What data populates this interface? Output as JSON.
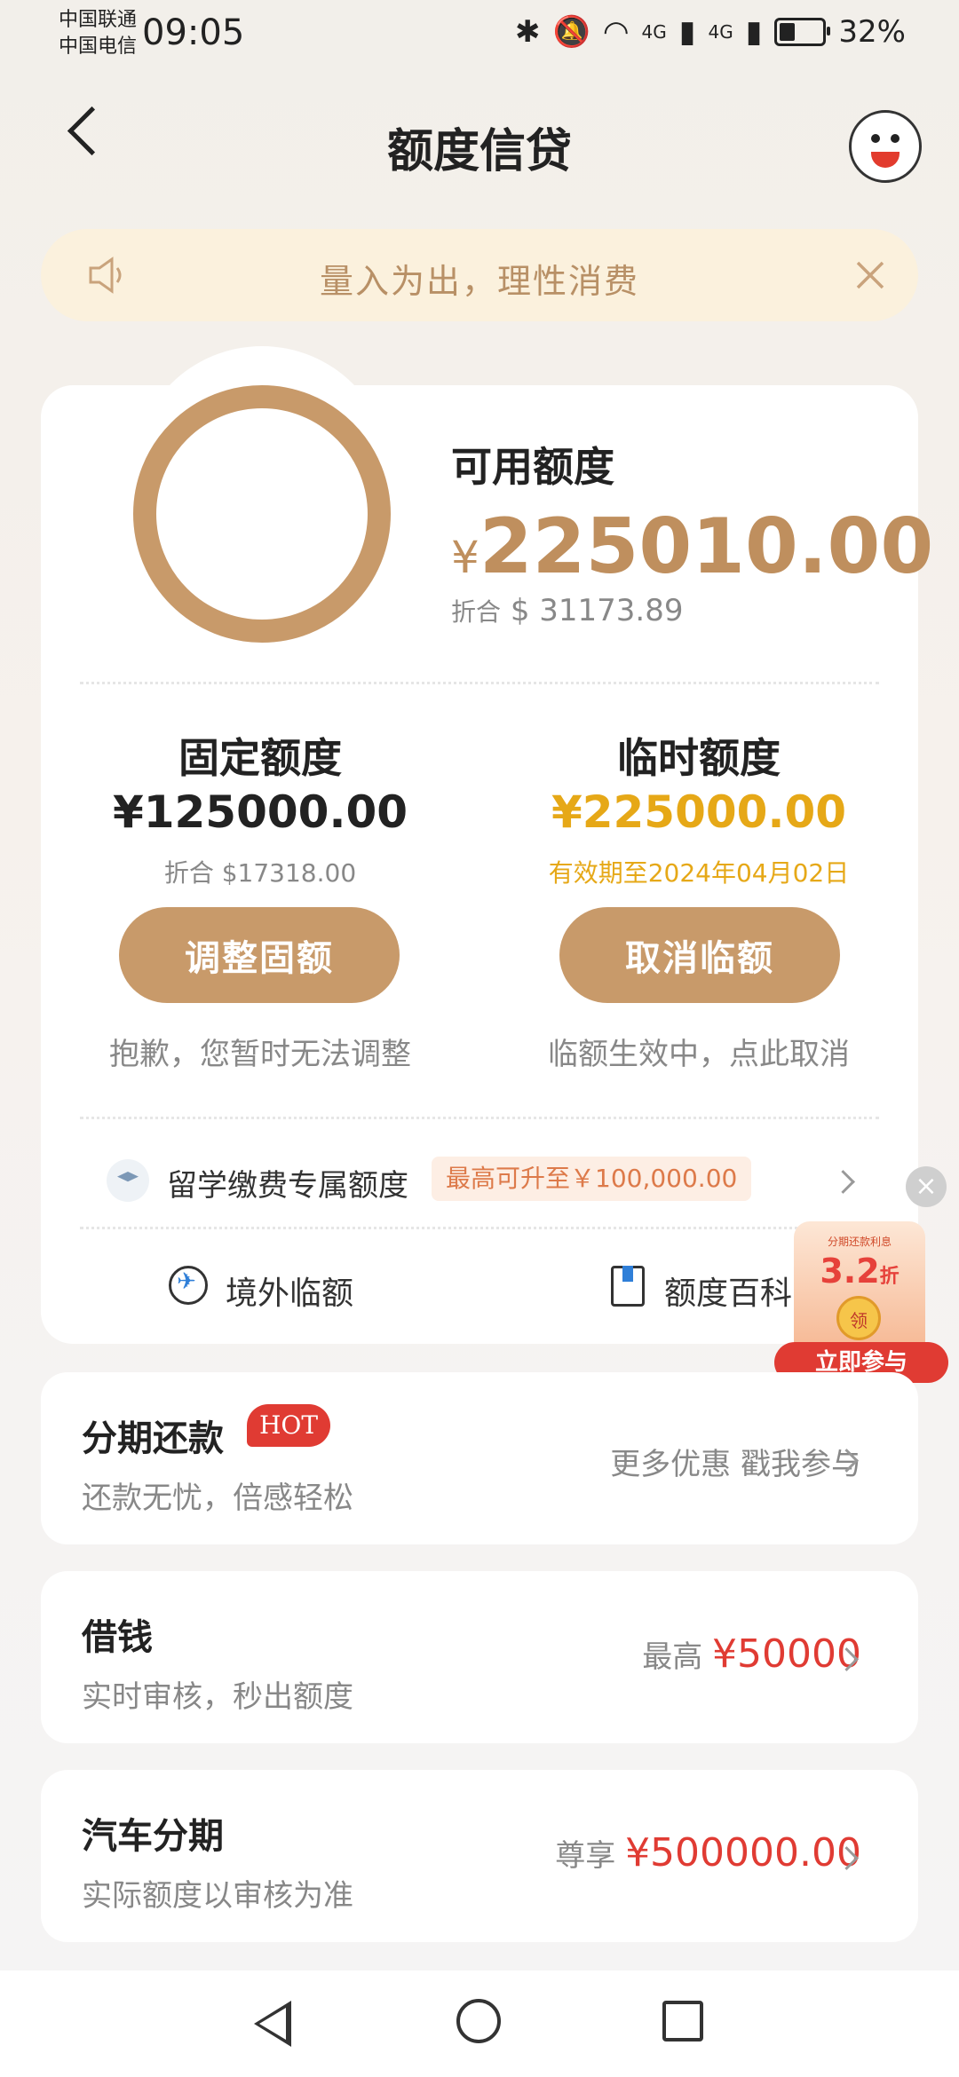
{
  "status_bar": {
    "carrier1": "中国联通",
    "carrier2": "中国电信",
    "time": "09:05",
    "signal1": "4G",
    "signal2": "4G",
    "battery": "32%"
  },
  "header": {
    "title": "额度信贷"
  },
  "notice": {
    "text": "量入为出，理性消费"
  },
  "credit": {
    "available_label": "可用额度",
    "currency": "¥",
    "available_amount": "225010.00",
    "conv_prefix": "折合",
    "conv_usd": "$ 31173.89"
  },
  "fixed": {
    "title": "固定额度",
    "amount": "¥125000.00",
    "conv": "折合 $17318.00",
    "button": "调整固额",
    "note": "抱歉，您暂时无法调整"
  },
  "temp": {
    "title": "临时额度",
    "amount": "¥225000.00",
    "validity": "有效期至2024年04月02日",
    "button": "取消临额",
    "note": "临额生效中，点此取消"
  },
  "study": {
    "text": "留学缴费专属额度",
    "tag": "最高可升至￥100,000.00"
  },
  "links": {
    "overseas": "境外临额",
    "encyclopedia": "额度百科"
  },
  "promo": {
    "small": "分期还款利息",
    "rate": "3.2",
    "unit": "折",
    "coin": "领",
    "button": "立即参与"
  },
  "rows": [
    {
      "title": "分期还款",
      "badge": "HOT",
      "sub": "还款无忧，倍感轻松",
      "right_text": "更多优惠 戳我参与"
    },
    {
      "title": "借钱",
      "sub": "实时审核，秒出额度",
      "right_prefix": "最高",
      "right_value": "¥50000"
    },
    {
      "title": "汽车分期",
      "sub": "实际额度以审核为准",
      "right_prefix": "尊享",
      "right_value": "¥500000.00"
    }
  ],
  "colors": {
    "accent": "#c89a6a",
    "gold": "#e6a817",
    "red": "#e03b33"
  }
}
